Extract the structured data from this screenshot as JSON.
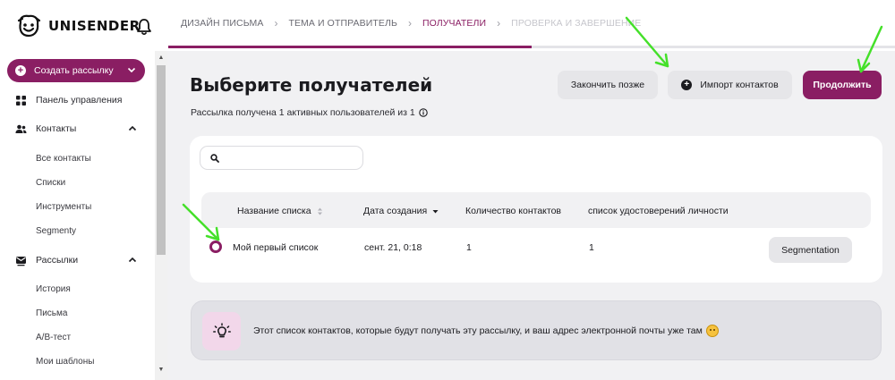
{
  "brand": {
    "name": "UNISENDER",
    "accent": "#8a1e63"
  },
  "steps": [
    {
      "label": "Дизайн письма",
      "state": "done"
    },
    {
      "label": "Тема и отправитель",
      "state": "done"
    },
    {
      "label": "Получатели",
      "state": "active"
    },
    {
      "label": "Проверка и завершение",
      "state": "disabled"
    }
  ],
  "progress": 0.5,
  "sidebar": {
    "create_label": "Создать рассылку",
    "dashboard": "Панель управления",
    "contacts": {
      "label": "Контакты",
      "items": [
        "Все контакты",
        "Списки",
        "Инструменты",
        "Segmenty"
      ]
    },
    "campaigns": {
      "label": "Рассылки",
      "items": [
        "История",
        "Письма",
        "A/B-тест",
        "Мои шаблоны"
      ]
    }
  },
  "main": {
    "title": "Выберите получателей",
    "subtitle": "Рассылка получена 1 активных пользователей из 1",
    "actions": {
      "later": "Закончить позже",
      "import": "Импорт контактов",
      "continue": "Продолжить"
    },
    "search": {
      "value": "",
      "placeholder": ""
    },
    "table": {
      "headers": [
        "Название списка",
        "Дата создания",
        "Количество контактов",
        "список удостоверений личности"
      ],
      "rows": [
        {
          "name": "Мой первый список",
          "date": "сент. 21, 0:18",
          "count": "1",
          "id": "1",
          "action": "Segmentation",
          "selected": true
        }
      ]
    },
    "tip": "Этот список контактов, которые будут получать эту рассылку, и ваш адрес электронной почты уже там"
  },
  "icons": {
    "logo": "smiley-logo-icon",
    "bell": "bell-icon",
    "info": "info-icon",
    "search": "search-icon",
    "tip": "lightbulb-icon"
  }
}
